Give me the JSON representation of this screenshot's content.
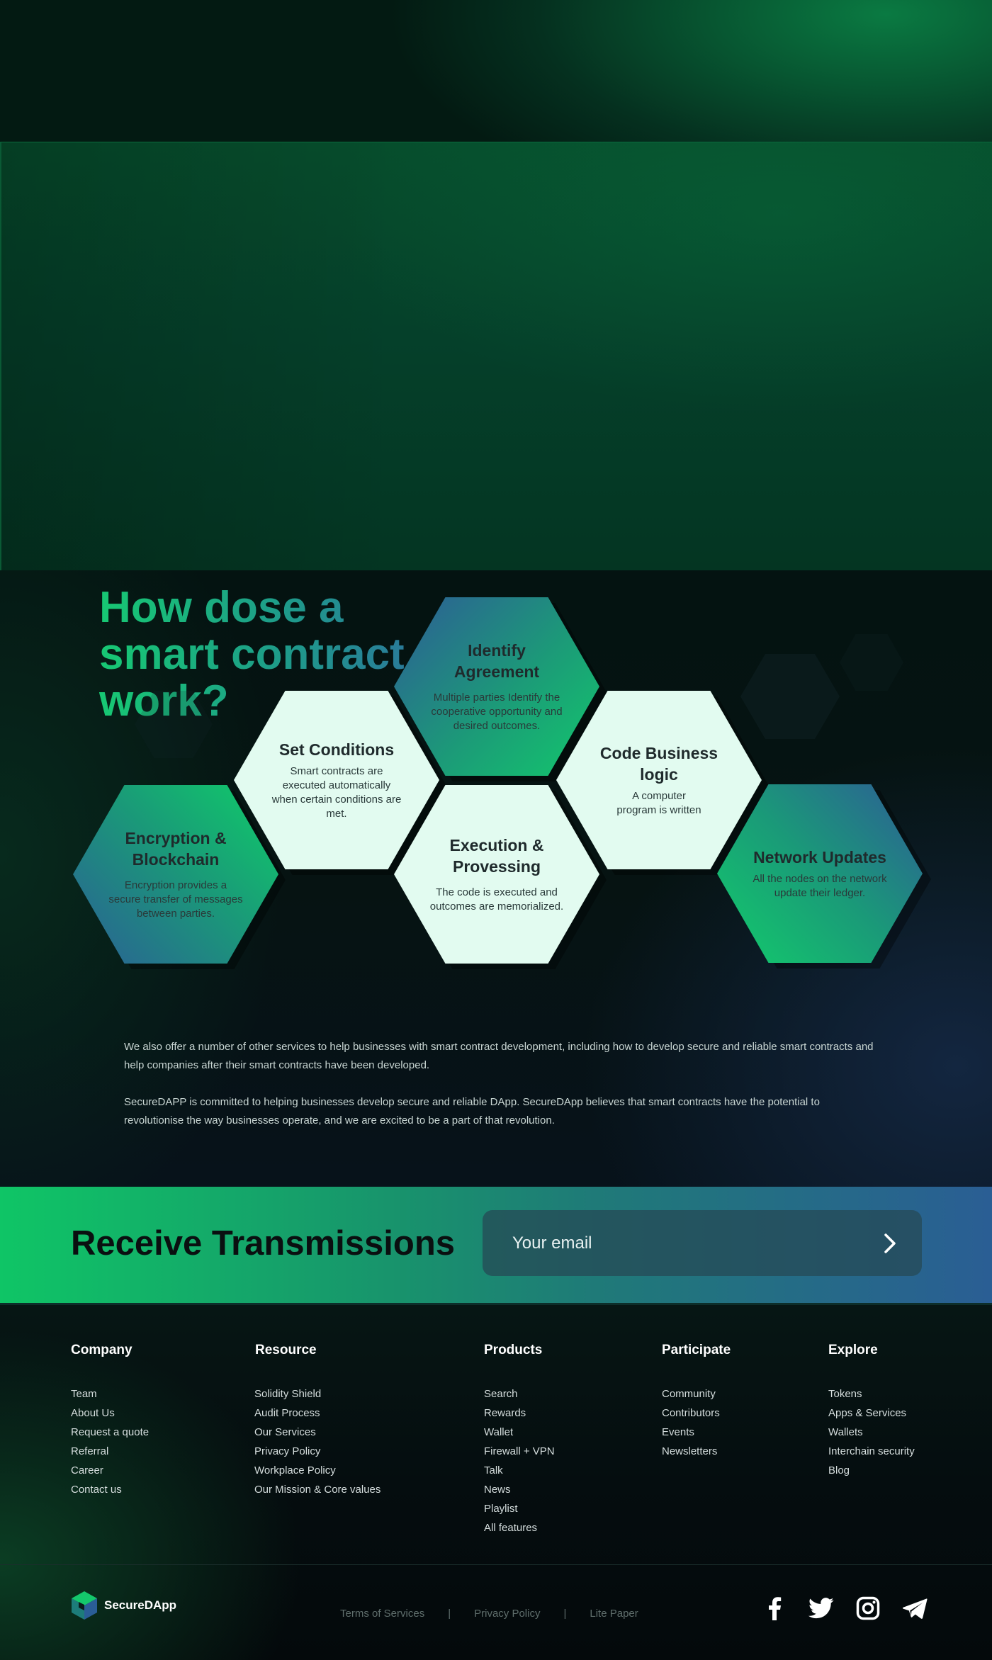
{
  "how": {
    "title_line1": "How dose a",
    "title_line2": "smart contract",
    "title_line3": "work?",
    "steps": [
      {
        "title": "Identify Agreement",
        "desc": "Multiple parties Identify the cooperative opportunity and desired outcomes."
      },
      {
        "title": "Set Conditions",
        "desc": "Smart contracts are executed automatically when certain conditions are met."
      },
      {
        "title": "Code Business logic",
        "desc": "A computer program is written"
      },
      {
        "title": "Encryption & Blockchain",
        "desc": "Encryption provides a secure transfer of messages between parties."
      },
      {
        "title": "Execution & Provessing",
        "desc": "The code is executed and outcomes are memorialized."
      },
      {
        "title": "Network Updates",
        "desc": "All the nodes on the network update their ledger."
      }
    ],
    "paragraph1": "We also offer a number of other services to help businesses with smart contract development, including how to develop secure and reliable smart contracts and help companies after their smart contracts have been developed.",
    "paragraph2": "SecureDAPP is committed to helping businesses develop secure and reliable DApp. SecureDApp believes that smart contracts have the potential to revolutionise the way businesses operate, and we are excited to be a part of that revolution."
  },
  "subscribe": {
    "title": "Receive Transmissions",
    "email_placeholder": "Your email",
    "submit_icon": "chevron-right-icon"
  },
  "footer": {
    "columns": [
      {
        "title": "Company",
        "items": [
          "Team",
          "About Us",
          "Request a quote",
          "Referral",
          "Career",
          "Contact us"
        ]
      },
      {
        "title": "Resource",
        "items": [
          "Solidity Shield",
          "Audit Process",
          "Our Services",
          "Privacy Policy",
          "Workplace Policy",
          "Our Mission & Core values"
        ]
      },
      {
        "title": "Products",
        "items": [
          "Search",
          "Rewards",
          "Wallet",
          "Firewall + VPN",
          "Talk",
          "News",
          "Playlist",
          "All features"
        ]
      },
      {
        "title": "Participate",
        "items": [
          "Community",
          "Contributors",
          "Events",
          "Newsletters"
        ]
      },
      {
        "title": "Explore",
        "items": [
          "Tokens",
          "Apps & Services",
          "Wallets",
          "Interchain security",
          "Blog"
        ]
      }
    ],
    "brand": "SecureDApp",
    "legal": {
      "terms": "Terms of Services",
      "privacy": "Privacy Policy",
      "lite": "Lite Paper",
      "separator": "|"
    },
    "socials": [
      "facebook-icon",
      "twitter-icon",
      "instagram-icon",
      "telegram-icon"
    ]
  },
  "colors": {
    "accent_green": "#12c86c",
    "accent_blue": "#2a5e94",
    "hex_light": "#e2fbf0"
  }
}
